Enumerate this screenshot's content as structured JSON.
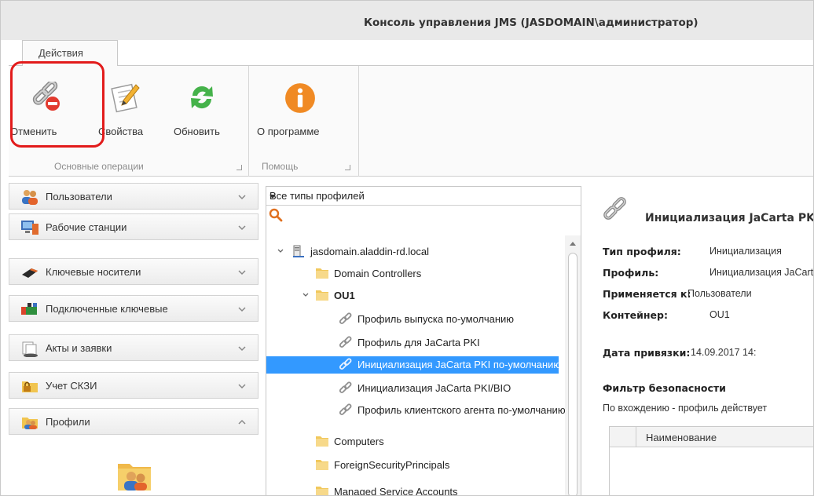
{
  "window": {
    "title": "Консоль управления JMS (JASDOMAIN\\администратор)"
  },
  "ribbon": {
    "tab": "Действия",
    "buttons": {
      "cancel": "Отменить",
      "properties": "Свойства",
      "refresh": "Обновить",
      "about": "О программе"
    },
    "groups": {
      "main": "Основные операции",
      "help": "Помощь"
    }
  },
  "nav": {
    "items": [
      {
        "label": "Пользователи",
        "icon": "users-icon",
        "expanded": false
      },
      {
        "label": "Рабочие станции",
        "icon": "workstation-icon",
        "expanded": false
      },
      {
        "label": "Ключевые носители",
        "icon": "key-token-icon",
        "expanded": false
      },
      {
        "label": "Подключенные ключевые",
        "icon": "connected-keys-icon",
        "expanded": false
      },
      {
        "label": "Акты и заявки",
        "icon": "documents-icon",
        "expanded": false
      },
      {
        "label": "Учет СКЗИ",
        "icon": "lock-folder-icon",
        "expanded": false
      },
      {
        "label": "Профили",
        "icon": "profiles-icon",
        "expanded": true
      }
    ]
  },
  "tree": {
    "filter": "Все типы профилей",
    "nodes": [
      {
        "label": "jasdomain.aladdin-rd.local",
        "icon": "server-icon"
      },
      {
        "label": "Domain Controllers",
        "icon": "folder-icon"
      },
      {
        "label": "OU1",
        "icon": "folder-icon"
      },
      {
        "label": "Профиль выпуска по-умолчанию",
        "icon": "link-icon"
      },
      {
        "label": "Профиль для JaCarta PKI",
        "icon": "link-icon"
      },
      {
        "label": "Инициализация JaCarta PKI по-умолчанию",
        "icon": "link-icon",
        "selected": true
      },
      {
        "label": "Инициализация JaCarta PKI/BIO",
        "icon": "link-icon"
      },
      {
        "label": "Профиль клиентского агента по-умолчанию",
        "icon": "link-icon"
      },
      {
        "label": "Computers",
        "icon": "folder-icon"
      },
      {
        "label": "ForeignSecurityPrincipals",
        "icon": "folder-icon"
      },
      {
        "label": "Managed Service Accounts",
        "icon": "folder-icon"
      }
    ]
  },
  "details": {
    "title": "Инициализация JaCarta PKI по-умолчанию",
    "props": [
      {
        "key": "Тип профиля:",
        "value": "Инициализация"
      },
      {
        "key": "Профиль:",
        "value": "Инициализация JaCarta PKI по-умолчанию"
      },
      {
        "key": "Применяется к:",
        "value": "Пользователи"
      },
      {
        "key": "Контейнер:",
        "value": "OU1"
      }
    ],
    "bind_date_key": "Дата привязки:",
    "bind_date_value": "14.09.2017 14:",
    "security_filter_title": "Фильтр безопасности",
    "security_filter_desc": "По вхождению - профиль действует",
    "grid_column": "Наименование"
  },
  "colors": {
    "selection": "#3399ff",
    "highlight": "#e21b1b"
  }
}
